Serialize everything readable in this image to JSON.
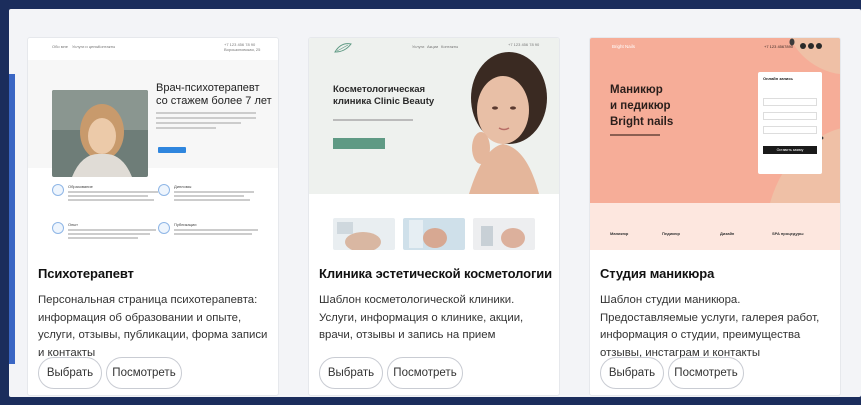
{
  "cards": [
    {
      "title": "Психотерапевт",
      "description": "Персональная страница психотерапевта: информация об образовании и опыте, услуги, отзывы, публикации, форма записи и контакты",
      "select_label": "Выбрать",
      "view_label": "Посмотреть",
      "preview": {
        "nav": [
          "Обо мне",
          "Услуги и цены",
          "Контакты"
        ],
        "phone": "+7 123 456 78 90",
        "address": "Ворошиловская, 25",
        "hero_title_1": "Врач-психотерапевт",
        "hero_title_2": "со стажем более 7 лет",
        "sections": [
          "Образование",
          "Дипломы",
          "Опыт",
          "Публикации"
        ],
        "accent": "#2f86de"
      }
    },
    {
      "title": "Клиника эстетической косметологии",
      "description": "Шаблон косметологической клиники. Услуги, информация о клинике, акции, врачи, отзывы и запись на прием",
      "select_label": "Выбрать",
      "view_label": "Посмотреть",
      "preview": {
        "nav": [
          "Услуги",
          "Акции",
          "Контакты"
        ],
        "phone": "+7 123 456 78 90",
        "hero_title_1": "Косметологическая",
        "hero_title_2": "клиника Clinic Beauty",
        "accent": "#5f9a84"
      }
    },
    {
      "title": "Студия маникюра",
      "description": "Шаблон студии маникюра. Предоставляемые услуги, галерея работ, информация о студии, преимущества отзывы, инстаграм и контакты",
      "select_label": "Выбрать",
      "view_label": "Посмотреть",
      "preview": {
        "brand": "Bright Nails",
        "phone": "+7 123 4567890",
        "hero_title_1": "Маникюр",
        "hero_title_2": "и педикюр",
        "hero_title_3": "Bright nails",
        "form_title": "Онлайн запись",
        "form_button": "Оставить заявку",
        "categories": [
          "Маникюр",
          "Педикюр",
          "Дизайн",
          "SPA процедуры"
        ],
        "accent": "#f6ad98"
      }
    }
  ]
}
